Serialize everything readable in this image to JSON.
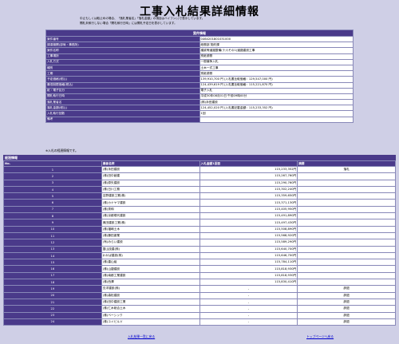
{
  "page": {
    "title": "工事入札結果詳細情報",
    "notes": [
      "中止もしくは取止めの場合、「落札業者名」「落札金額」の項目はハイフン(-)で表示しています。",
      "開札未執行しない場合「開札執行日時」には開札予定日を表示しています。"
    ]
  },
  "info": {
    "header": "案件情報",
    "rows": [
      {
        "label": "案件番号",
        "value": "0464201801031000"
      },
      {
        "label": "調達機関(部局・事務所)",
        "value": "総務部 契約課"
      },
      {
        "label": "案件名称",
        "value": "橋梁等道路整備(十六その1)道路建設工事"
      },
      {
        "label": "工事場所",
        "value": "別紙参照"
      },
      {
        "label": "入札方式",
        "value": "一般競争入札"
      },
      {
        "label": "種別",
        "value": "土木一式工事"
      },
      {
        "label": "工期",
        "value": "別紙参照"
      },
      {
        "label": "予定価格(税込)",
        "value": "139,910,700 円 (入札書比較価格：129,547,000 円)"
      },
      {
        "label": "最低制限価格(税込)",
        "value": "124,439,619 円 (入札書比較価格：115,221,870 円)"
      },
      {
        "label": "紙・電子区分",
        "value": "電子入札"
      },
      {
        "label": "開札執行日時",
        "value": "平成30年08月01日 午前09時00分"
      },
      {
        "label": "落札業者名",
        "value": "(株)永田建設"
      },
      {
        "label": "落札金額(税込)",
        "value": "124,452,020 円 (入札書記載金額：115,233,352 円)"
      },
      {
        "label": "入札執行回数",
        "value": "1回"
      },
      {
        "label": "備考",
        "value": ""
      }
    ]
  },
  "note2": "※入札の経過情報です。",
  "bids": {
    "header": "経過情報",
    "columns": {
      "no": "No.",
      "name": "業者名称",
      "amount": "入札金額1回目",
      "remark": "摘要"
    },
    "rows": [
      {
        "no": "1",
        "name": "(株)永田建設",
        "amount": "115,233,352円",
        "remark": "落札"
      },
      {
        "no": "2",
        "name": "(株)田中創建",
        "amount": "115,267,760円",
        "remark": ""
      },
      {
        "no": "3",
        "name": "(株)原矢建設",
        "amount": "115,290,760円",
        "remark": ""
      },
      {
        "no": "4",
        "name": "(株)日川工務",
        "amount": "115,302,240円",
        "remark": ""
      },
      {
        "no": "5",
        "name": "吉野建設工業(株)",
        "amount": "115,359,650円",
        "remark": ""
      },
      {
        "no": "6",
        "name": "(株)カナヤマ建設",
        "amount": "115,371,130円",
        "remark": ""
      },
      {
        "no": "7",
        "name": "(株)秀和",
        "amount": "115,405,950円",
        "remark": ""
      },
      {
        "no": "8",
        "name": "(株)京都現代建設",
        "amount": "115,491,890円",
        "remark": ""
      },
      {
        "no": "9",
        "name": "奥田建設工業(株)",
        "amount": "115,497,430円",
        "remark": ""
      },
      {
        "no": "10",
        "name": "(株)福嶋土木",
        "amount": "115,508,890円",
        "remark": ""
      },
      {
        "no": "11",
        "name": "(株)藤田産業",
        "amount": "115,568,920円",
        "remark": ""
      },
      {
        "no": "12",
        "name": "(有)みらい建設",
        "amount": "115,589,290円",
        "remark": ""
      },
      {
        "no": "13",
        "name": "富山技建(株)",
        "amount": "115,640,700円",
        "remark": ""
      },
      {
        "no": "14",
        "name": "わかば建設(株)",
        "amount": "115,646,700円",
        "remark": ""
      },
      {
        "no": "15",
        "name": "(株)喜山組",
        "amount": "115,784,110円",
        "remark": ""
      },
      {
        "no": "16",
        "name": "(株)山捷建設",
        "amount": "115,818,930円",
        "remark": ""
      },
      {
        "no": "17",
        "name": "(株)南都工業建設",
        "amount": "115,818,930円",
        "remark": ""
      },
      {
        "no": "18",
        "name": "(株)西澤",
        "amount": "115,830,410円",
        "remark": ""
      },
      {
        "no": "19",
        "name": "玄洋建設(株)",
        "amount": "-",
        "remark": "辞退"
      },
      {
        "no": "20",
        "name": "(株)森松建設",
        "amount": "-",
        "remark": "辞退"
      },
      {
        "no": "21",
        "name": "(株)田中建設工業",
        "amount": "-",
        "remark": "辞退"
      },
      {
        "no": "22",
        "name": "(株)仁木総合土木",
        "amount": "-",
        "remark": "辞退"
      },
      {
        "no": "23",
        "name": "(株)ベーシック",
        "amount": "-",
        "remark": "辞退"
      },
      {
        "no": "24",
        "name": "(株)ユイビルド",
        "amount": "-",
        "remark": "辞退"
      }
    ]
  },
  "links": {
    "back": "入札結果一覧に戻る",
    "top": "トップページへ戻る"
  }
}
